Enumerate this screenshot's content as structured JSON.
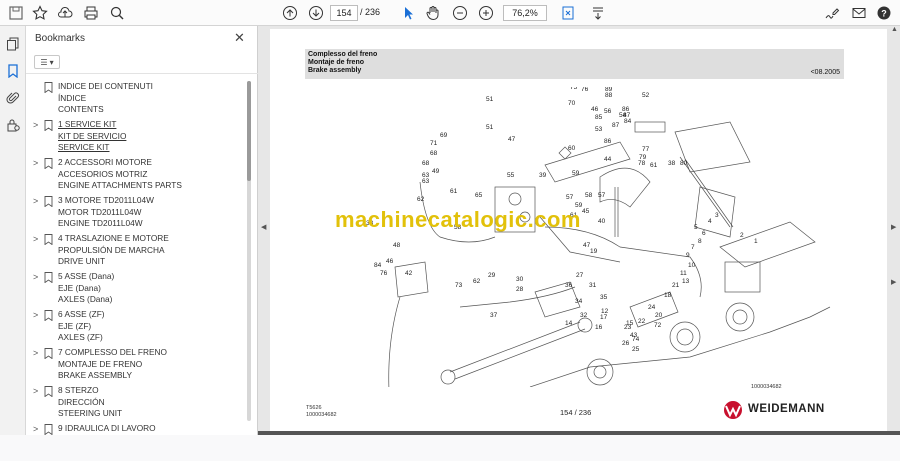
{
  "toolbar": {
    "page_current": "154",
    "page_total": "/ 236",
    "zoom": "76,2%",
    "icons": [
      "save-icon",
      "bookmark-star-icon",
      "upload-icon",
      "print-icon",
      "zoom-search-icon",
      "page-up-icon",
      "page-down-icon",
      "select-cursor-icon",
      "hand-tool-icon",
      "zoom-out-icon",
      "zoom-in-icon",
      "fit-page-icon",
      "scroll-mode-icon",
      "sign-icon",
      "email-icon",
      "help-icon"
    ]
  },
  "rail": {
    "icons": [
      "copy-pages-icon",
      "bookmark-icon",
      "attachment-icon",
      "security-lock-icon"
    ]
  },
  "bookmarks": {
    "title": "Bookmarks",
    "items": [
      {
        "expand": "",
        "lines": [
          "INDICE DEI CONTENUTI",
          "ÍNDICE",
          "CONTENTS"
        ]
      },
      {
        "expand": ">",
        "lines": [
          "1 SERVICE KIT",
          "KIT DE SERVICIO",
          "SERVICE KIT"
        ]
      },
      {
        "expand": ">",
        "lines": [
          "2 ACCESSORI MOTORE",
          "ACCESORIOS MOTRIZ",
          "ENGINE ATTACHMENTS PARTS"
        ]
      },
      {
        "expand": ">",
        "lines": [
          "3 MOTORE TD2011L04W",
          "MOTOR TD2011L04W",
          "ENGINE TD2011L04W"
        ]
      },
      {
        "expand": ">",
        "lines": [
          "4 TRASLAZIONE E MOTORE",
          "PROPULSIÓN DE MARCHA",
          "DRIVE UNIT"
        ]
      },
      {
        "expand": ">",
        "lines": [
          "5 ASSE (Dana)",
          "EJE (Dana)",
          "AXLES (Dana)"
        ]
      },
      {
        "expand": ">",
        "lines": [
          "6 ASSE (ZF)",
          "EJE (ZF)",
          "AXLES (ZF)"
        ]
      },
      {
        "expand": ">",
        "lines": [
          "7 COMPLESSO DEL FRENO",
          "MONTAJE DE FRENO",
          "BRAKE ASSEMBLY"
        ]
      },
      {
        "expand": ">",
        "lines": [
          "8 STERZO",
          "DIRECCIÓN",
          "STEERING UNIT"
        ]
      },
      {
        "expand": ">",
        "lines": [
          "9 IDRAULICA DI LAVORO",
          "",
          ""
        ]
      }
    ]
  },
  "page": {
    "header_line1": "Complesso del freno",
    "header_line2": "Montaje de freno",
    "header_line3": "Brake assembly",
    "header_date": "<08.2005",
    "watermark": "machinecatalogic.com",
    "drawing_id": "1000034682",
    "footer_code1": "T5626",
    "footer_code2": "1000034682",
    "footer_page": "154 / 236",
    "brand": "WEIDEMANN",
    "brand_color": "#c8102e",
    "callouts": [
      "75",
      "76",
      "70",
      "89",
      "88",
      "52",
      "51",
      "51",
      "47",
      "46",
      "56",
      "85",
      "86",
      "87",
      "84",
      "53",
      "54",
      "87",
      "86",
      "71",
      "69",
      "68",
      "68",
      "63",
      "49",
      "63",
      "62",
      "39",
      "55",
      "59",
      "60",
      "44",
      "77",
      "79",
      "78",
      "80",
      "38",
      "61",
      "61",
      "65",
      "58",
      "57",
      "59",
      "58",
      "45",
      "57",
      "61",
      "40",
      "33",
      "47",
      "19",
      "48",
      "46",
      "42",
      "84",
      "76",
      "73",
      "62",
      "29",
      "30",
      "28",
      "27",
      "36",
      "37",
      "31",
      "34",
      "35",
      "32",
      "17",
      "12",
      "16",
      "14",
      "15",
      "72",
      "74",
      "43",
      "26",
      "25",
      "23",
      "22",
      "24",
      "20",
      "18",
      "21",
      "13",
      "11",
      "10",
      "9",
      "7",
      "8",
      "6",
      "5",
      "4",
      "3",
      "2",
      "1"
    ]
  }
}
